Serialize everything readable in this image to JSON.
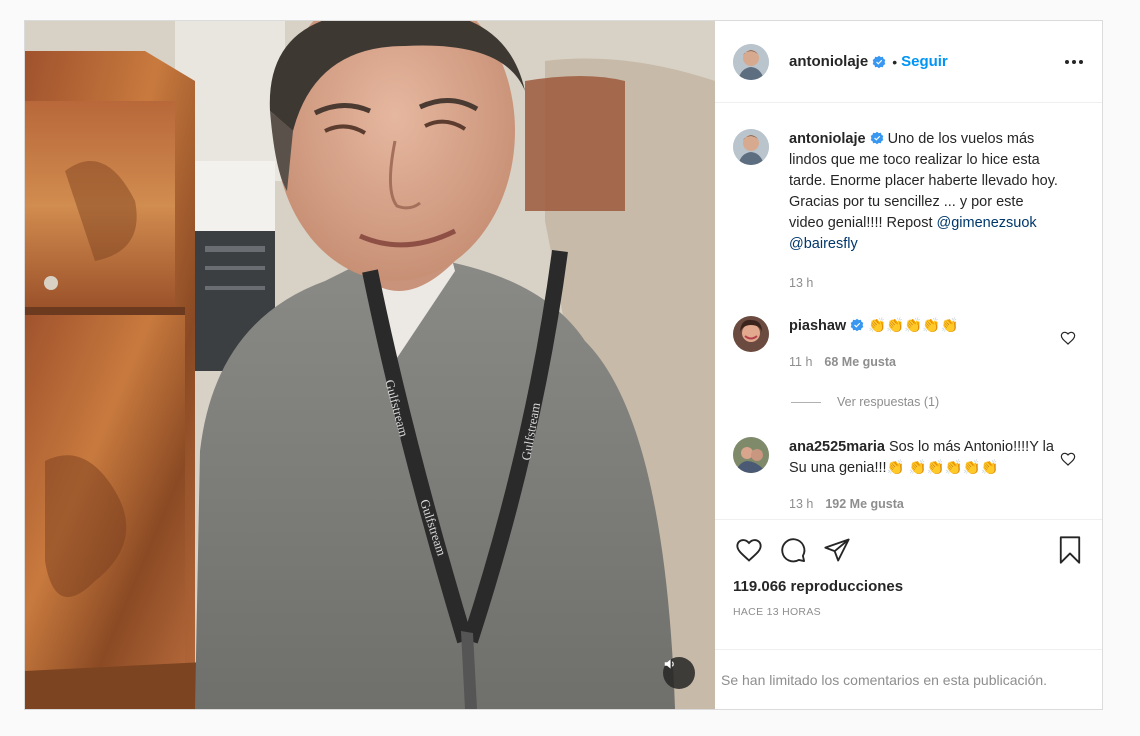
{
  "post": {
    "author": {
      "username": "antoniolaje",
      "verified": true,
      "follow_label": "Seguir",
      "separator": "•"
    },
    "caption": {
      "username": "antoniolaje",
      "text_before": " Uno de los vuelos más lindos que me toco realizar lo hice esta tarde. Enorme placer haberte llevado hoy. Gracias por tu sencillez ... y por este video genial!!!! Repost ",
      "mention1": "@gimenezsuok",
      "mention2": "@bairesfly",
      "time": "13 h"
    },
    "comments": [
      {
        "username": "piashaw",
        "verified": true,
        "text": " 👏👏👏👏👏",
        "time": "11 h",
        "likes": "68 Me gusta",
        "replies": "Ver respuestas (1)"
      },
      {
        "username": "ana2525maria",
        "verified": false,
        "text": " Sos lo más Antonio!!!!Y la Su una genia!!!👏 👏👏👏👏👏",
        "time": "13 h",
        "likes": "192 Me gusta"
      }
    ],
    "views": "119.066 reproducciones",
    "time_ago": "HACE 13 HORAS",
    "comments_limited": "Se han limitado los comentarios en esta publicación.",
    "icons": {
      "like": "heart-icon",
      "comment": "comment-icon",
      "share": "share-icon",
      "save": "bookmark-icon",
      "more": "more-options-icon",
      "mute": "speaker-icon",
      "verified": "verified-badge-icon"
    },
    "colors": {
      "follow": "#0095f6",
      "verified": "#3897f0",
      "mention": "#00376b",
      "muted_text": "#8e8e8e"
    },
    "video": {
      "lanyard_text": "Gulfstream"
    }
  }
}
